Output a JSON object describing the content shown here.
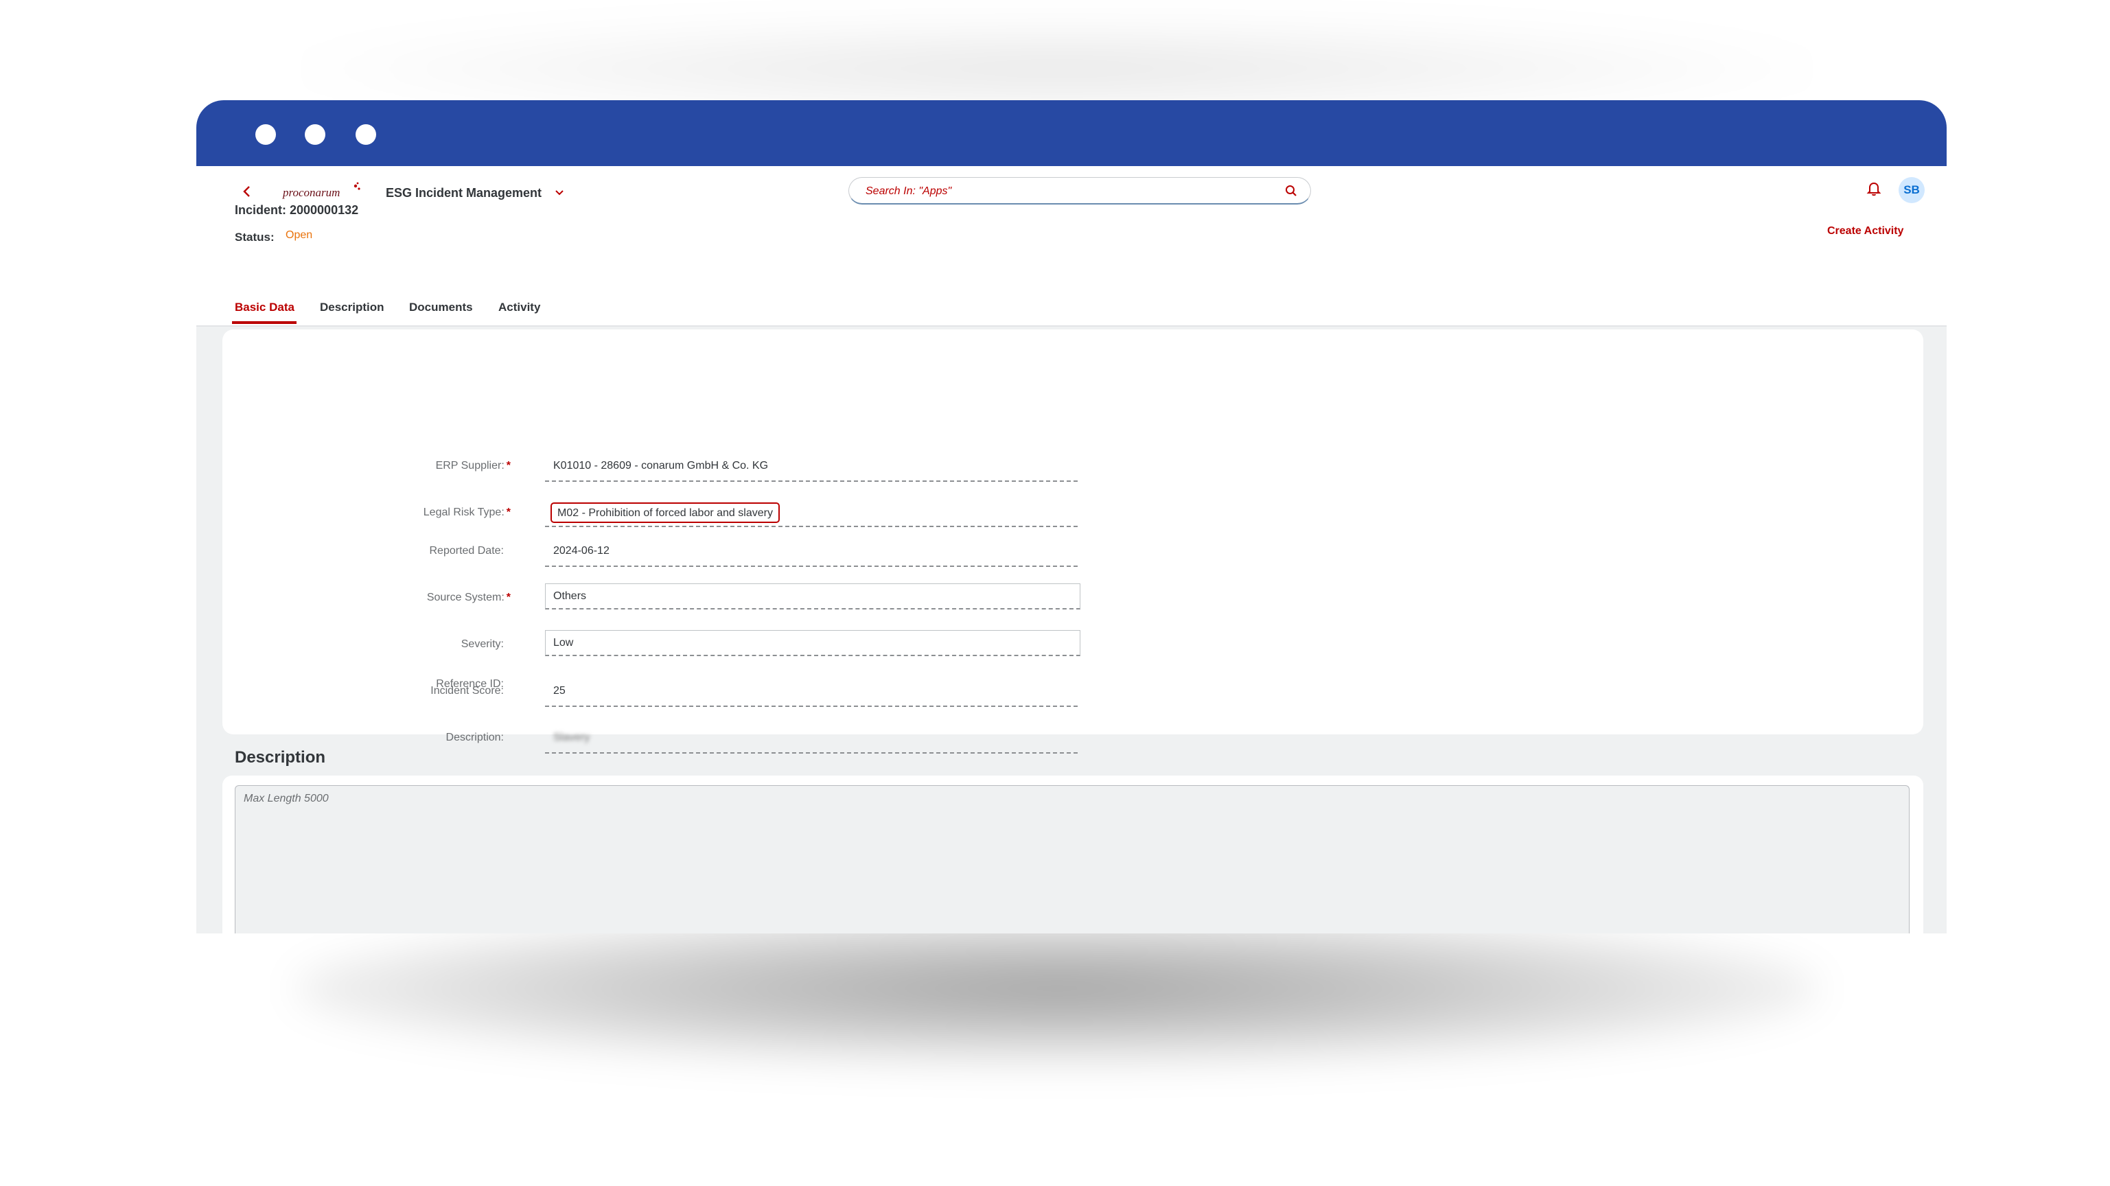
{
  "shell": {
    "app_title": "ESG Incident Management",
    "logo_text": "proconarum",
    "search_placeholder": "Search In: \"Apps\"",
    "avatar_initials": "SB"
  },
  "header": {
    "incident_title": "Incident: 2000000132",
    "status_label": "Status:",
    "status_value": "Open",
    "create_activity": "Create Activity"
  },
  "tabs": [
    {
      "label": "Basic Data",
      "active": true
    },
    {
      "label": "Description",
      "active": false
    },
    {
      "label": "Documents",
      "active": false
    },
    {
      "label": "Activity",
      "active": false
    }
  ],
  "form": {
    "erp_supplier": {
      "label": "ERP Supplier:",
      "value": "K01010 - 28609 - conarum GmbH & Co. KG",
      "required": true
    },
    "legal_risk_type": {
      "label": "Legal Risk Type:",
      "value": "M02 - Prohibition of forced labor and slavery",
      "required": true
    },
    "reported_date": {
      "label": "Reported Date:",
      "value": "2024-06-12"
    },
    "source_system": {
      "label": "Source System:",
      "value": "Others",
      "required": true
    },
    "severity": {
      "label": "Severity:",
      "value": "Low"
    },
    "incident_score": {
      "label": "Incident Score:",
      "value": "25"
    },
    "description": {
      "label": "Description:",
      "value": "Slavery"
    },
    "reference_id": {
      "label": "Reference ID:",
      "value": ""
    }
  },
  "description_section": {
    "title": "Description",
    "placeholder": "Max Length 5000"
  },
  "colors": {
    "titlebar": "#2749a3",
    "accent": "#bb0000",
    "status_open": "#e9730c"
  }
}
